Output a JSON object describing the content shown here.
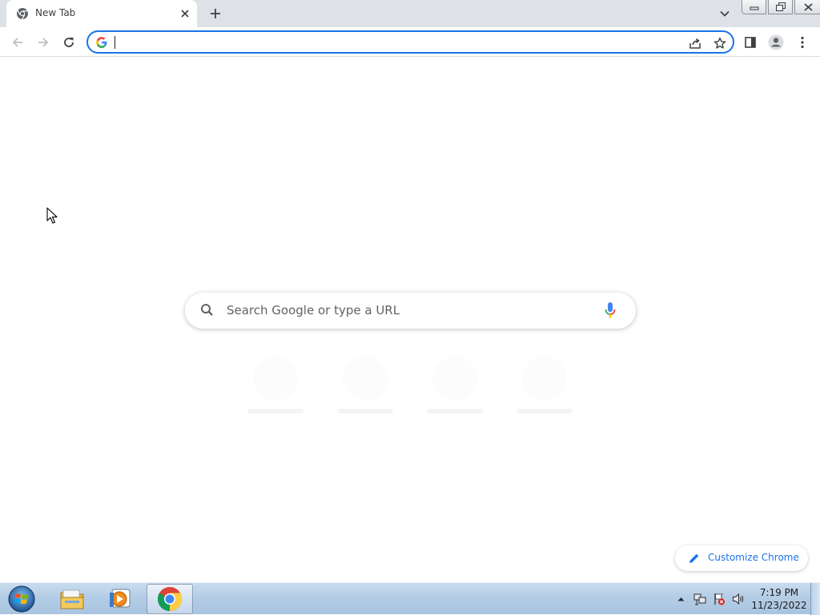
{
  "tab": {
    "title": "New Tab",
    "close_icon": "close-icon",
    "favicon": "chrome-favicon-icon"
  },
  "tabstrip": {
    "new_tab_icon": "plus-icon",
    "tab_search_icon": "chevron-down-icon"
  },
  "window_controls": [
    "minimize-icon",
    "restore-icon",
    "close-icon"
  ],
  "toolbar": {
    "back_icon": "arrow-left-icon",
    "forward_icon": "arrow-right-icon",
    "reload_icon": "reload-icon",
    "omnibox_value": "",
    "share_icon": "share-icon",
    "bookmark_icon": "star-icon",
    "side_panel_icon": "side-panel-icon",
    "profile_icon": "avatar-icon",
    "menu_icon": "kebab-menu-icon"
  },
  "ntp": {
    "search_placeholder": "Search Google or type a URL",
    "customize_label": "Customize Chrome"
  },
  "taskbar": {
    "apps": [
      "windows-start-icon",
      "file-explorer-icon",
      "media-player-icon",
      "chrome-icon"
    ],
    "clock_time": "7:19 PM",
    "clock_date": "11/23/2022"
  },
  "colors": {
    "accent": "#1a73e8",
    "tabstrip_bg": "#dee1e6",
    "taskbar_bg": "#b4cde6"
  }
}
